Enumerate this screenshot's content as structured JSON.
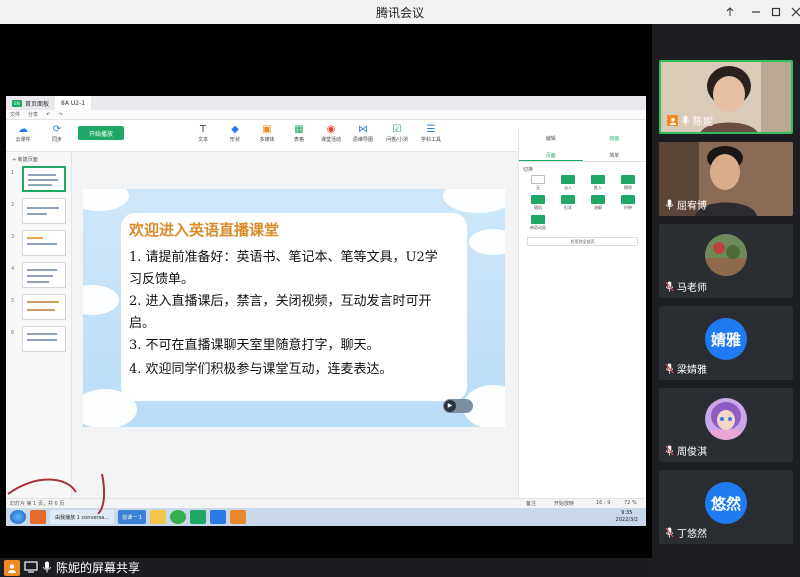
{
  "window": {
    "title": "腾讯会议"
  },
  "share_bar": {
    "label": "陈妮的屏幕共享"
  },
  "ppt_app": {
    "tabs": [
      "首页面板",
      "8A U2-1"
    ],
    "menu": [
      "文件",
      "分享"
    ],
    "toolbar": {
      "start_label": "开始播放",
      "tools": [
        "文本",
        "形状",
        "多媒体",
        "表格",
        "课堂活动",
        "思维导图",
        "问卷/小测",
        "学科工具"
      ],
      "left_tools": [
        "云课件",
        "同步"
      ]
    },
    "new_page_label": "新建页面",
    "slide": {
      "title": "欢迎进入英语直播课堂",
      "items": [
        "1. 请提前准备好：英语书、笔记本、笔等文具，U2学习反馈单。",
        "2. 进入直播课后，禁言，关闭视频，互动发言时可开启。",
        "3. 不可在直播课聊天室里随意打字，聊天。",
        "4. 欢迎同学们积极参与课堂互动，连麦表达。"
      ]
    },
    "right_panel": {
      "top_tabs": [
        "编辑",
        "动画"
      ],
      "tabs": [
        "页面",
        "简单"
      ],
      "section": "切换",
      "effects": [
        "无",
        "淡入",
        "推入",
        "擦除",
        "随机",
        "形状",
        "溶解",
        "时钟",
        "神奇动画"
      ],
      "apply_all": "应用到全部页"
    },
    "status": {
      "left": "幻灯片 第 1 页，共 6 页",
      "notes": "备注",
      "start": "开始放映",
      "ratio": "16 : 9",
      "zoom": "72 %"
    },
    "taskbar": {
      "items": [
        "由我播放 1 conversa...",
        "授课一 1"
      ],
      "time": "9:35",
      "date": "2022/3/2"
    }
  },
  "participants": [
    {
      "name": "陈妮",
      "type": "video",
      "speaking": true
    },
    {
      "name": "屈宥博",
      "type": "video",
      "speaking": false
    },
    {
      "name": "马老师",
      "type": "photo",
      "speaking": false
    },
    {
      "name": "梁婧雅",
      "type": "initials",
      "initials": "婧雅",
      "speaking": false
    },
    {
      "name": "周俊淇",
      "type": "photo",
      "speaking": false
    },
    {
      "name": "丁悠然",
      "type": "initials",
      "initials": "悠然",
      "speaking": false
    }
  ],
  "colors": {
    "brand_green": "#1fa865",
    "avatar_blue": "#1e7bf2",
    "speaking_border": "#2fbf5e",
    "share_orange": "#f08a24"
  }
}
